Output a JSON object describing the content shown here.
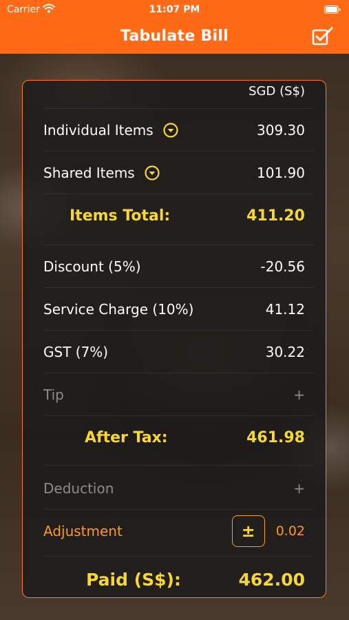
{
  "status_bar": {
    "carrier": "Carrier",
    "time": "11:07 PM"
  },
  "nav": {
    "title": "Tabulate Bill",
    "action_icon": "checklist-icon"
  },
  "colors": {
    "accent": "#ff6a17",
    "highlight": "#f7d733",
    "adjustment": "#ff9a1f",
    "muted": "#8c8c8c"
  },
  "bill": {
    "currency": "SGD (S$)",
    "individual_items": {
      "label": "Individual Items",
      "value": "309.30",
      "icon": "chevron-down-circle-icon"
    },
    "shared_items": {
      "label": "Shared Items",
      "value": "101.90",
      "icon": "chevron-down-circle-icon"
    },
    "items_total": {
      "label": "Items Total:",
      "value": "411.20"
    },
    "discount": {
      "label": "Discount (5%)",
      "value": "-20.56"
    },
    "service_charge": {
      "label": "Service Charge (10%)",
      "value": "41.12"
    },
    "gst": {
      "label": "GST (7%)",
      "value": "30.22"
    },
    "tip": {
      "label": "Tip",
      "action": "+"
    },
    "after_tax": {
      "label": "After Tax:",
      "value": "461.98"
    },
    "deduction": {
      "label": "Deduction",
      "action": "+"
    },
    "adjustment": {
      "label": "Adjustment",
      "button": "±",
      "value": "0.02"
    },
    "paid": {
      "label": "Paid (S$):",
      "value": "462.00"
    }
  }
}
